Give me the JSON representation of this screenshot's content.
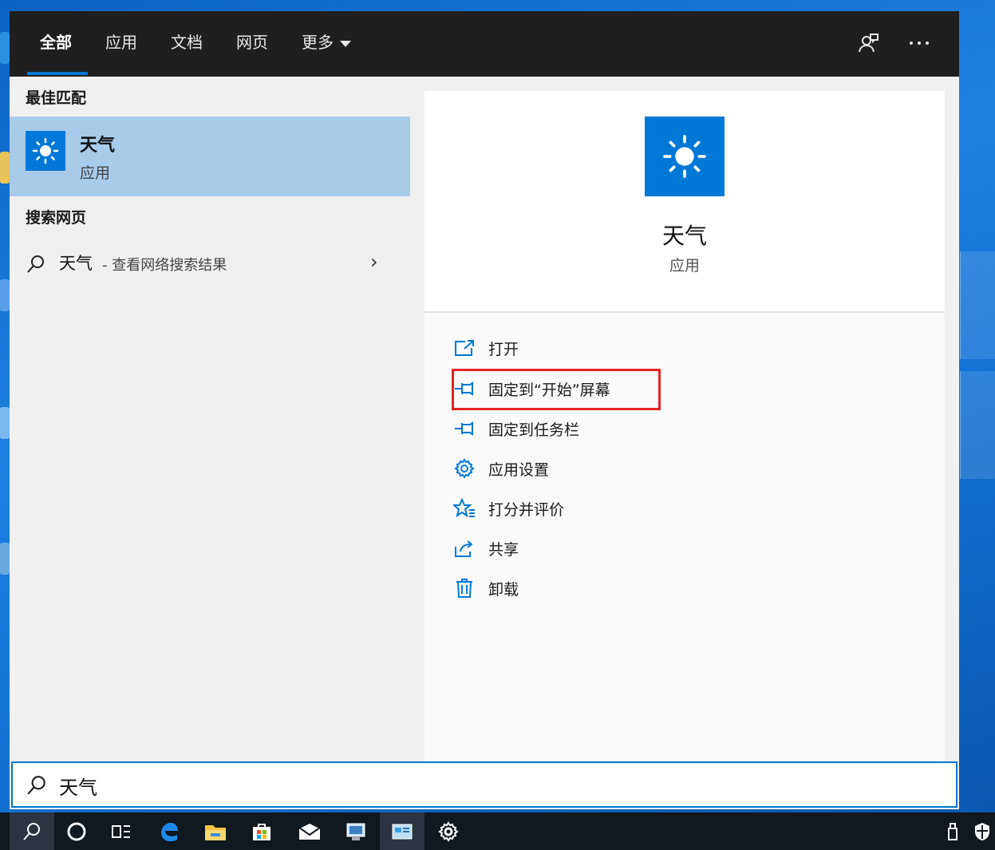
{
  "tabs": [
    {
      "label": "全部"
    },
    {
      "label": "应用"
    },
    {
      "label": "文档"
    },
    {
      "label": "网页"
    },
    {
      "label": "更多"
    }
  ],
  "left": {
    "best_match_title": "最佳匹配",
    "best_match": {
      "name": "天气",
      "type": "应用"
    },
    "web_title": "搜索网页",
    "web_result": {
      "query": "天气",
      "suffix": "- 查看网络搜索结果"
    }
  },
  "detail": {
    "name": "天气",
    "type": "应用",
    "actions": [
      {
        "label": "打开",
        "icon": "open-icon"
      },
      {
        "label": "固定到“开始”屏幕",
        "icon": "pin-icon"
      },
      {
        "label": "固定到任务栏",
        "icon": "pin-icon"
      },
      {
        "label": "应用设置",
        "icon": "gear-icon"
      },
      {
        "label": "打分并评价",
        "icon": "star-icon"
      },
      {
        "label": "共享",
        "icon": "share-icon"
      },
      {
        "label": "卸载",
        "icon": "trash-icon"
      }
    ]
  },
  "search": {
    "value": "天气"
  },
  "colors": {
    "accent": "#0078d7",
    "highlight": "#e02424",
    "selected": "#a8cbea"
  }
}
